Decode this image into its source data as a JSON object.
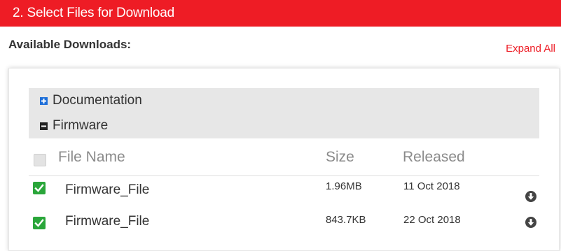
{
  "header": {
    "title": "2. Select Files for Download",
    "color": "#ee1c25"
  },
  "downloads": {
    "label": "Available Downloads:",
    "expand_all": "Expand All"
  },
  "categories": [
    {
      "label": "Documentation",
      "state": "collapsed",
      "icon": "plus-square-icon"
    },
    {
      "label": "Firmware",
      "state": "expanded",
      "icon": "minus-square-icon"
    }
  ],
  "table": {
    "columns": [
      "File Name",
      "Size",
      "Released"
    ],
    "rows": [
      {
        "name": "Firmware_File",
        "size": "1.96MB",
        "released": "11 Oct 2018",
        "checked": true,
        "icon": "download-icon"
      },
      {
        "name": "Firmware_File",
        "size": "843.7KB",
        "released": "22 Oct 2018",
        "checked": true,
        "icon": "download-icon"
      }
    ]
  },
  "colors": {
    "checkbox_checked": "#2aa63a",
    "category_bg": "#e7e7e7",
    "link": "#ee1c25",
    "expand_icon": "#1e6fd9"
  }
}
